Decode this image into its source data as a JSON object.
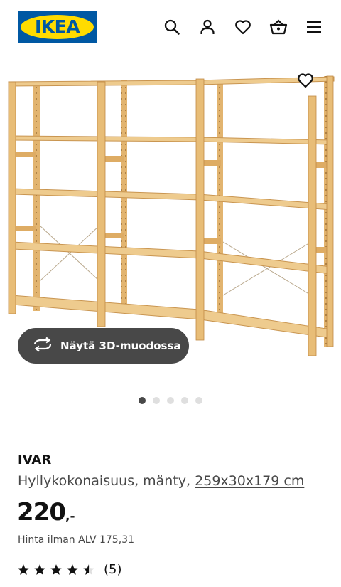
{
  "header": {
    "logo_text": "IKEA",
    "brand_colors": {
      "blue": "#0058a3",
      "yellow": "#ffdb00"
    },
    "icons": [
      "search-icon",
      "account-icon",
      "heart-icon",
      "basket-icon",
      "menu-icon"
    ]
  },
  "gallery": {
    "view_3d_label": "Näytä 3D-muodossa",
    "image_count": 5,
    "active_index": 1
  },
  "product": {
    "name": "IVAR",
    "description": "Hyllykokonaisuus, mänty,",
    "measurements": "259x30x179 cm",
    "price_integer": "220",
    "price_suffix": ",-",
    "vat_text": "Hinta ilman ALV 175,31",
    "rating_value": 4.5,
    "rating_max": 5,
    "review_count": "(5)"
  }
}
